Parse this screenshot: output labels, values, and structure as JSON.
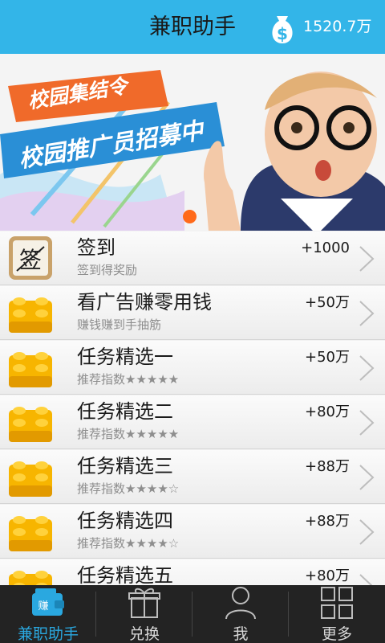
{
  "header": {
    "title": "兼职助手",
    "balance": "1520.7万",
    "accent_color": "#33b5e8",
    "icon": "money-bag-icon"
  },
  "banner": {
    "line1": "校园集结令",
    "line2": "校园推广员招募中"
  },
  "list": [
    {
      "name": "签到",
      "sub": "签到得奖励",
      "reward": "+1000",
      "icon": "checkin-icon"
    },
    {
      "name": "看广告赚零用钱",
      "sub": "赚钱赚到手抽筋",
      "reward": "+50万",
      "icon": "lego-brick-icon"
    },
    {
      "name": "任务精选一",
      "sub": "推荐指数★★★★★",
      "reward": "+50万",
      "icon": "lego-brick-icon"
    },
    {
      "name": "任务精选二",
      "sub": "推荐指数★★★★★",
      "reward": "+80万",
      "icon": "lego-brick-icon"
    },
    {
      "name": "任务精选三",
      "sub": "推荐指数★★★★☆",
      "reward": "+88万",
      "icon": "lego-brick-icon"
    },
    {
      "name": "任务精选四",
      "sub": "推荐指数★★★★☆",
      "reward": "+88万",
      "icon": "lego-brick-icon"
    },
    {
      "name": "任务精选五",
      "sub": "",
      "reward": "+80万",
      "icon": "lego-brick-icon"
    }
  ],
  "tabs": [
    {
      "label": "兼职助手",
      "icon": "wallet-icon",
      "active": true
    },
    {
      "label": "兑换",
      "icon": "gift-icon",
      "active": false
    },
    {
      "label": "我",
      "icon": "person-icon",
      "active": false
    },
    {
      "label": "更多",
      "icon": "grid-icon",
      "active": false
    }
  ]
}
